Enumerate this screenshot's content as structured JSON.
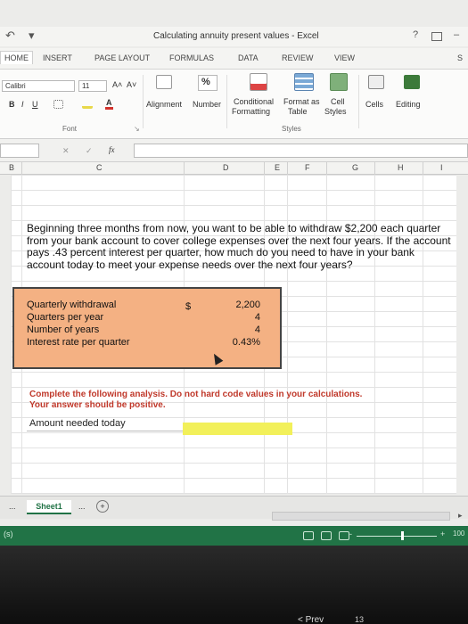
{
  "window": {
    "title": "Calculating annuity present values - Excel",
    "help": "?",
    "minimize": "–"
  },
  "tabs": [
    {
      "label": "HOME"
    },
    {
      "label": "INSERT"
    },
    {
      "label": "PAGE LAYOUT"
    },
    {
      "label": "FORMULAS"
    },
    {
      "label": "DATA"
    },
    {
      "label": "REVIEW"
    },
    {
      "label": "VIEW"
    },
    {
      "label": "S"
    }
  ],
  "ribbon": {
    "font_name": "Calibri",
    "font_size": "11",
    "grow_font": "A˄",
    "shrink_font": "A˅",
    "bold": "B",
    "italic": "I",
    "underline": "U",
    "font_group": "Font",
    "alignment": "Alignment",
    "number_symbol": "%",
    "number": "Number",
    "conditional_formatting": [
      "Conditional",
      "Formatting"
    ],
    "format_as_table": [
      "Format as",
      "Table"
    ],
    "cell_styles": [
      "Cell",
      "Styles"
    ],
    "styles_group": "Styles",
    "cells": "Cells",
    "editing": "Editing"
  },
  "formula_bar": {
    "fx": "fx",
    "cancel": "✕",
    "enter": "✓"
  },
  "columns": [
    "B",
    "C",
    "D",
    "E",
    "F",
    "G",
    "H",
    "I"
  ],
  "problem_text": "Beginning three months from now, you want to be able to withdraw $2,200 each quarter from your bank account to cover college expenses over the next four years. If the account pays .43 percent interest per quarter, how much do you need to have in your bank account today to meet your expense needs over the next four years?",
  "inputs": {
    "currency": "$",
    "rows": [
      {
        "label": "Quarterly withdrawal",
        "value": "2,200"
      },
      {
        "label": "Quarters per year",
        "value": "4"
      },
      {
        "label": "Number of years",
        "value": "4"
      },
      {
        "label": "Interest rate per quarter",
        "value": "0.43%"
      }
    ]
  },
  "instruction_line1": "Complete the following analysis. Do not hard code values in your calculations.",
  "instruction_line2": "Your answer should be positive.",
  "answer": {
    "label": "Amount needed today",
    "value": ""
  },
  "sheet": {
    "ellipsis": "...",
    "name": "Sheet1",
    "ellipsis2": "...",
    "add": "+"
  },
  "status": {
    "text": "(s)",
    "zoom_minus": "-",
    "zoom_plus": "+",
    "zoom": "100"
  },
  "nav": {
    "prev": "< Prev",
    "page": "13"
  },
  "colors": {
    "accent": "#217346",
    "input_fill": "#f4b183",
    "answer_fill": "#f2f05a",
    "instruction": "#c0392b"
  }
}
